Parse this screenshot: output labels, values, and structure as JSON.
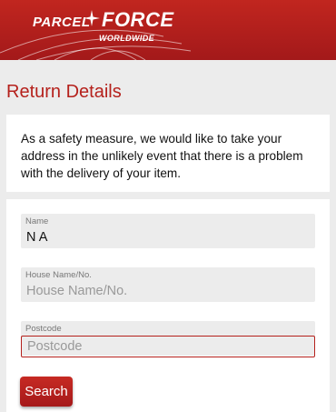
{
  "brand": {
    "word1": "PARCEL",
    "word2": "FORCE",
    "tagline": "WORLDWIDE",
    "colors": {
      "primary": "#b5211c",
      "dark": "#a3191a"
    }
  },
  "page": {
    "title": "Return Details"
  },
  "notice": {
    "text": "As a safety measure, we would like to take your address in the unlikely event that there is a problem with the delivery of your item."
  },
  "form": {
    "name": {
      "label": "Name",
      "value": "N A",
      "placeholder": "Name"
    },
    "house": {
      "label": "House Name/No.",
      "value": "",
      "placeholder": "House Name/No."
    },
    "postcode": {
      "label": "Postcode",
      "value": "",
      "placeholder": "Postcode"
    },
    "search_label": "Search"
  }
}
